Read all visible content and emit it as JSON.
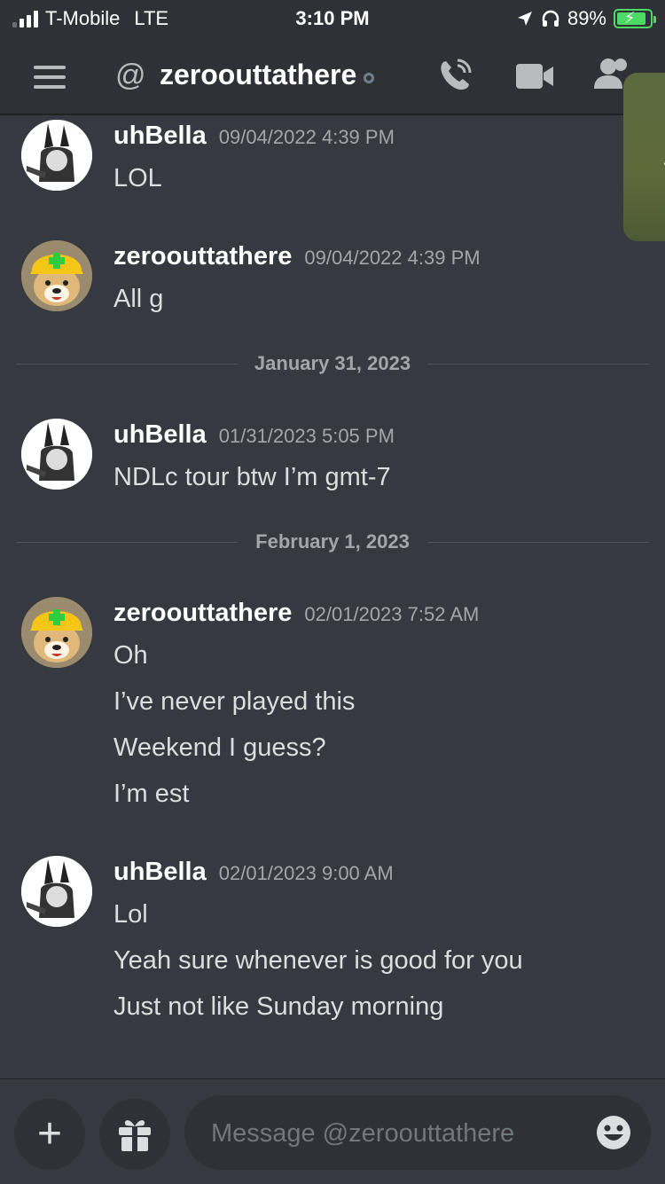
{
  "status_bar": {
    "carrier": "T-Mobile",
    "network": "LTE",
    "time": "3:10 PM",
    "battery": "89%",
    "battery_level": 0.89
  },
  "header": {
    "channel_name": "zeroouttathere",
    "icons": [
      "menu-icon",
      "at-icon",
      "call-icon",
      "video-icon",
      "members-icon"
    ]
  },
  "messages": [
    {
      "author": "uhBella",
      "timestamp": "09/04/2022 4:39 PM",
      "lines": [
        "LOL"
      ]
    },
    {
      "author": "zeroouttathere",
      "timestamp": "09/04/2022 4:39 PM",
      "lines": [
        "All g"
      ]
    },
    {
      "divider": "January 31, 2023"
    },
    {
      "author": "uhBella",
      "timestamp": "01/31/2023 5:05 PM",
      "lines": [
        "NDLc tour btw I’m gmt-7"
      ]
    },
    {
      "divider": "February 1, 2023"
    },
    {
      "author": "zeroouttathere",
      "timestamp": "02/01/2023 7:52 AM",
      "lines": [
        "Oh",
        "I’ve never played this",
        "Weekend I guess?",
        "I’m est"
      ]
    },
    {
      "author": "uhBella",
      "timestamp": "02/01/2023 9:00 AM",
      "lines": [
        "Lol",
        "Yeah sure whenever is good for you",
        "Just not like Sunday morning"
      ]
    }
  ],
  "composer": {
    "placeholder": "Message @zeroouttathere",
    "value": ""
  },
  "colors": {
    "background": "#36393f",
    "header": "#2f3136",
    "text": "#dcddde",
    "muted": "#a3a6aa",
    "battery": "#4cd964"
  }
}
